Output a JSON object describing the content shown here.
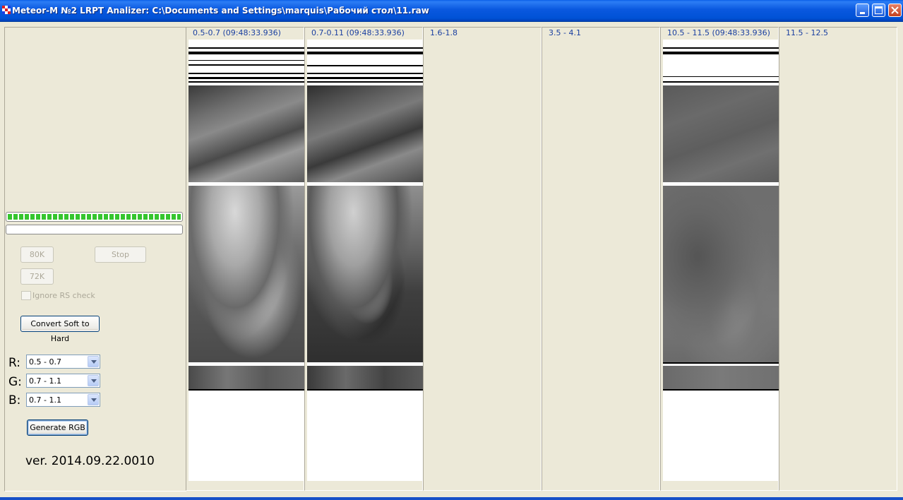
{
  "window": {
    "title": "Meteor-M №2 LRPT Analizer: C:\\Documents and Settings\\marquis\\Рабочий стол\\11.raw",
    "icon": "app-icon",
    "controls": [
      "minimize-icon",
      "maximize-icon",
      "close-icon"
    ]
  },
  "left_panel": {
    "progress": {
      "signal_fraction": 1.0,
      "second_fraction": 0.0
    },
    "buttons": {
      "b80k": "80K",
      "stop": "Stop",
      "b72k": "72K",
      "convert": "Convert Soft to Hard",
      "generate": "Generate RGB"
    },
    "ignore_rs_label": "Ignore RS check",
    "rgb": {
      "r_label": "R:",
      "r_value": "0.5 - 0.7",
      "g_label": "G:",
      "g_value": "0.7 - 1.1",
      "b_label": "B:",
      "b_value": "0.7 - 1.1"
    },
    "version": "ver. 2014.09.22.0010"
  },
  "channels": [
    {
      "label": "0.5-0.7 (09:48:33.936)",
      "has_image": true
    },
    {
      "label": "0.7-0.11 (09:48:33.936)",
      "has_image": true
    },
    {
      "label": "1.6-1.8",
      "has_image": false
    },
    {
      "label": "3.5 - 4.1",
      "has_image": false
    },
    {
      "label": "10.5 - 11.5 (09:48:33.936)",
      "has_image": true
    },
    {
      "label": "11.5 - 12.5",
      "has_image": false
    }
  ],
  "colors": {
    "titlebar": "#0052d6",
    "face": "#ece9d8",
    "channel_label": "#1a3fa0",
    "progress_green": "#35c52e"
  }
}
